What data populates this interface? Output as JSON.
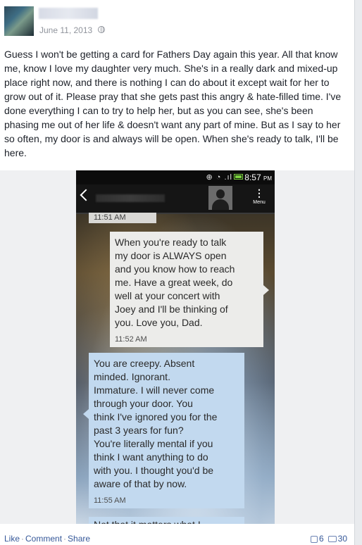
{
  "post": {
    "date": "June 11, 2013",
    "text": "Guess I won't be getting a card for Fathers Day again this year. All that know me, know I love my daughter very much. She's in a really dark and mixed-up place right now, and there is nothing I can do about it except wait for her to grow out of it. Please pray that she gets past this angry & hate-filled time. I've done everything I can to try to help her, but as you can see, she's been phasing me out of her life & doesn't want any part of mine. But as I say to her so often, my door is and always will be open. When she's ready to talk, I'll be here."
  },
  "phone": {
    "status_icons": "⊕ ◔ .ıl",
    "clock_time": "8:57",
    "clock_ampm": "PM",
    "menu_label": "Menu",
    "top_time": "11:51 AM",
    "messages": [
      {
        "text": "When you're ready to talk\nmy door is ALWAYS open\nand you know how to reach\nme. Have a great week, do\nwell at your concert with\nJoey and I'll be thinking of\nyou. Love you, Dad.",
        "time": "11:52 AM"
      },
      {
        "text": "You are creepy. Absent\nminded. Ignorant.\nImmature. I will never come\nthrough your door. You\nthink I've ignored you for the\npast 3 years for fun?\nYou're literally mental if you\nthink I want anything to do\nwith you. I thought you'd be\naware of that by now.",
        "time": "11:55 AM"
      },
      {
        "text": "Not that it matters what I"
      }
    ]
  },
  "footer": {
    "like": "Like",
    "comment": "Comment",
    "share": "Share",
    "like_count": "6",
    "comment_count": "30"
  }
}
